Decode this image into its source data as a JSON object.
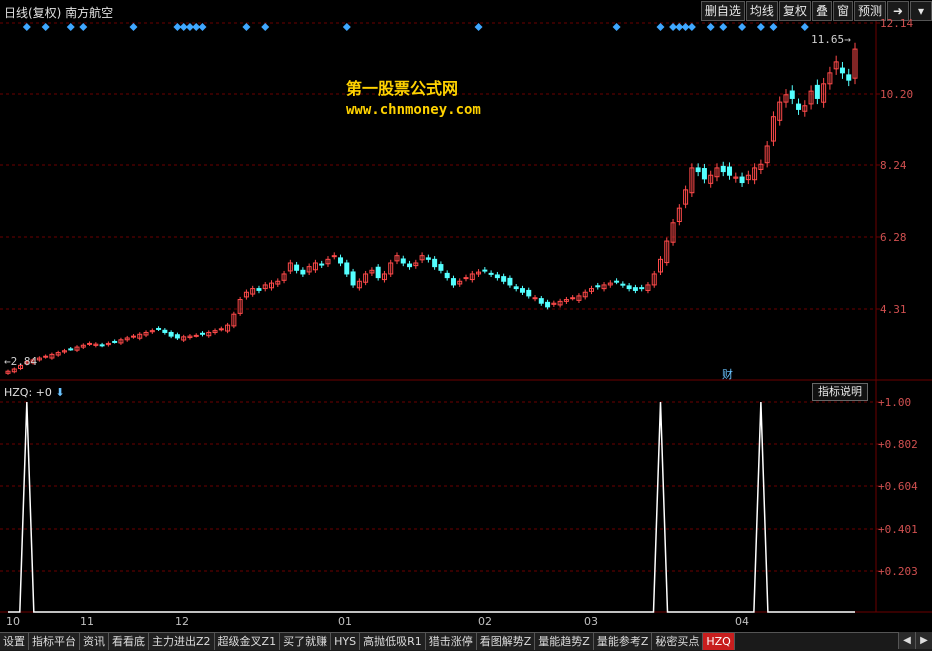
{
  "header": {
    "title": "日线(复权)  南方航空",
    "toolbar": [
      "删自选",
      "均线",
      "复权",
      "叠",
      "窗",
      "预测"
    ],
    "toolbar_icons": [
      "pin-icon",
      "dropdown-icon"
    ]
  },
  "watermark": {
    "line1": "第一股票公式网",
    "line2": "www.chnmoney.com"
  },
  "price_axis": [
    "12.14",
    "10.20",
    "8.24",
    "6.28",
    "4.31"
  ],
  "highest_label": "11.65→",
  "lowest_label": "←2.84",
  "news_marker": "财",
  "indicator": {
    "name": "HZQ: +0",
    "desc_button": "指标说明",
    "axis": [
      "+1.00",
      "+0.802",
      "+0.604",
      "+0.401",
      "+0.203"
    ]
  },
  "time_axis": [
    "10",
    "11",
    "12",
    "01",
    "02",
    "03",
    "04"
  ],
  "tabs": [
    "设置",
    "指标平台",
    "资讯",
    "看看底",
    "主力进出Z2",
    "超级金叉Z1",
    "买了就赚",
    "HYS",
    "高抛低吸R1",
    "猎击涨停",
    "看图解势Z",
    "量能趋势Z",
    "量能参考Z",
    "秘密买点",
    "HZQ"
  ],
  "active_tab": "HZQ",
  "colors": {
    "up": "#ff4a4a",
    "down": "#54ffff",
    "grid": "#6b0000",
    "diamond": "#3fa7ff",
    "watermark": "#ffd200",
    "indicator_line": "#ffffff"
  },
  "chart_data": {
    "type": "candlestick",
    "price_range": [
      2.6,
      12.5
    ],
    "ohlc_note": "daily candles, approximate closing path",
    "closes": [
      2.84,
      2.9,
      3.0,
      3.1,
      3.15,
      3.2,
      3.25,
      3.3,
      3.35,
      3.4,
      3.45,
      3.5,
      3.55,
      3.6,
      3.58,
      3.55,
      3.6,
      3.65,
      3.7,
      3.75,
      3.8,
      3.85,
      3.9,
      3.95,
      4.0,
      3.9,
      3.8,
      3.75,
      3.78,
      3.8,
      3.82,
      3.85,
      3.9,
      3.95,
      4.0,
      4.1,
      4.4,
      4.8,
      5.0,
      5.1,
      5.05,
      5.2,
      5.25,
      5.3,
      5.5,
      5.8,
      5.6,
      5.5,
      5.7,
      5.8,
      5.75,
      5.9,
      6.0,
      5.8,
      5.5,
      5.2,
      5.3,
      5.5,
      5.6,
      5.4,
      5.5,
      5.8,
      6.0,
      5.8,
      5.7,
      5.8,
      6.0,
      5.9,
      5.7,
      5.6,
      5.4,
      5.2,
      5.3,
      5.4,
      5.5,
      5.55,
      5.6,
      5.5,
      5.4,
      5.3,
      5.2,
      5.1,
      5.0,
      4.9,
      4.85,
      4.7,
      4.6,
      4.7,
      4.75,
      4.8,
      4.85,
      4.9,
      5.0,
      5.1,
      5.15,
      5.2,
      5.25,
      5.3,
      5.2,
      5.1,
      5.05,
      5.1,
      5.2,
      5.5,
      5.9,
      6.4,
      6.9,
      7.3,
      7.8,
      8.4,
      8.3,
      8.1,
      8.2,
      8.4,
      8.3,
      8.2,
      8.15,
      8.0,
      8.2,
      8.4,
      8.5,
      9.0,
      9.8,
      10.2,
      10.4,
      10.3,
      10.0,
      10.1,
      10.5,
      10.3,
      10.7,
      11.0,
      11.3,
      11.0,
      10.8,
      11.65
    ],
    "signals_index": [
      3,
      104,
      120
    ],
    "signal_values": [
      1,
      1,
      1
    ],
    "indicator_range": [
      0,
      1.0
    ]
  }
}
